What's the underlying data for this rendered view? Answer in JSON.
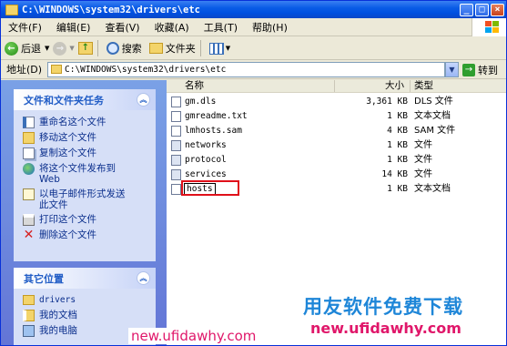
{
  "window": {
    "title": "C:\\WINDOWS\\system32\\drivers\\etc"
  },
  "menu": [
    "文件(F)",
    "编辑(E)",
    "查看(V)",
    "收藏(A)",
    "工具(T)",
    "帮助(H)"
  ],
  "toolbar": {
    "back": "后退",
    "search": "搜索",
    "folders": "文件夹"
  },
  "address": {
    "label": "地址(D)",
    "value": "C:\\WINDOWS\\system32\\drivers\\etc",
    "go": "转到"
  },
  "file_tasks": {
    "header": "文件和文件夹任务",
    "items": [
      {
        "label": "重命名这个文件",
        "icon": "rename-icon"
      },
      {
        "label": "移动这个文件",
        "icon": "move-icon"
      },
      {
        "label": "复制这个文件",
        "icon": "copy-icon"
      },
      {
        "label": "将这个文件发布到\nWeb",
        "icon": "globe-icon"
      },
      {
        "label": "以电子邮件形式发送\n此文件",
        "icon": "email-icon"
      },
      {
        "label": "打印这个文件",
        "icon": "print-icon"
      },
      {
        "label": "删除这个文件",
        "icon": "delete-icon"
      }
    ]
  },
  "other_places": {
    "header": "其它位置",
    "items": [
      {
        "label": "drivers",
        "icon": "folder-icon"
      },
      {
        "label": "我的文档",
        "icon": "my-documents-icon"
      },
      {
        "label": "我的电脑",
        "icon": "my-computer-icon"
      }
    ]
  },
  "columns": {
    "name": "名称",
    "size": "大小",
    "type": "类型"
  },
  "files": [
    {
      "name": "gm.dls",
      "size": "3,361 KB",
      "type": "DLS 文件",
      "icon": "file-icon"
    },
    {
      "name": "gmreadme.txt",
      "size": "1 KB",
      "type": "文本文档",
      "icon": "text-file-icon"
    },
    {
      "name": "lmhosts.sam",
      "size": "4 KB",
      "type": "SAM 文件",
      "icon": "file-icon"
    },
    {
      "name": "networks",
      "size": "1 KB",
      "type": "文件",
      "icon": "file-icon"
    },
    {
      "name": "protocol",
      "size": "1 KB",
      "type": "文件",
      "icon": "file-icon"
    },
    {
      "name": "services",
      "size": "14 KB",
      "type": "文件",
      "icon": "file-icon"
    },
    {
      "name": "hosts",
      "size": "1 KB",
      "type": "文本文档",
      "icon": "text-file-icon"
    }
  ],
  "watermark": {
    "brand": "用友软件免费下载",
    "url1": "new.ufidawhy.com",
    "url2": "new.ufidawhy.com"
  },
  "colors": {
    "title_blue": "#0a5ce6",
    "highlight_red": "#e0101a",
    "watermark_blue": "#1e86d8",
    "watermark_pink": "#e0176a"
  }
}
